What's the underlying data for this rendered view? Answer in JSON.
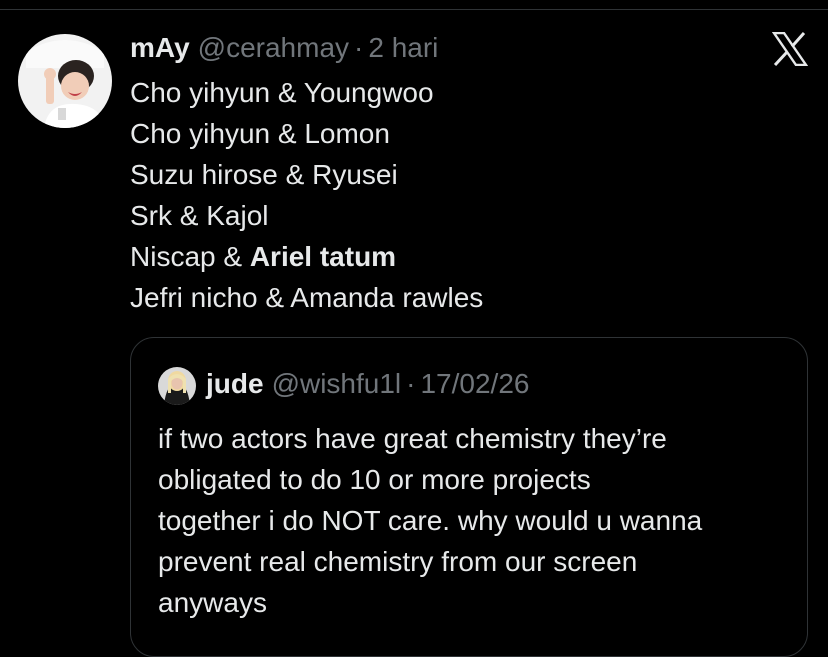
{
  "tweet": {
    "author": {
      "display_name": "mAy",
      "handle": "@cerahmay",
      "avatar_icon": "profile-photo-avatar"
    },
    "separator": "·",
    "time": "2 hari",
    "close_icon": "x-logo-icon",
    "lines": [
      {
        "plain": "Cho yihyun & Youngwoo",
        "bold": ""
      },
      {
        "plain": "Cho yihyun & Lomon",
        "bold": ""
      },
      {
        "plain": "Suzu hirose & Ryusei",
        "bold": ""
      },
      {
        "plain": "Srk & Kajol",
        "bold": ""
      },
      {
        "plain": "Niscap & ",
        "bold": "Ariel tatum"
      },
      {
        "plain": "Jefri nicho & Amanda rawles",
        "bold": ""
      }
    ]
  },
  "quoted_tweet": {
    "author": {
      "display_name": "jude",
      "handle": "@wishfu1l",
      "avatar_icon": "profile-photo-avatar"
    },
    "separator": "·",
    "date": "17/02/26",
    "lines": [
      "if two actors have great chemistry they’re",
      "obligated to do 10 or more projects",
      "together i do NOT care. why would u wanna",
      "prevent real chemistry from our screen",
      "anyways"
    ]
  },
  "colors": {
    "background": "#000000",
    "primary_text": "#e7e9ea",
    "secondary_text": "#71767b",
    "border": "#2f3336"
  }
}
